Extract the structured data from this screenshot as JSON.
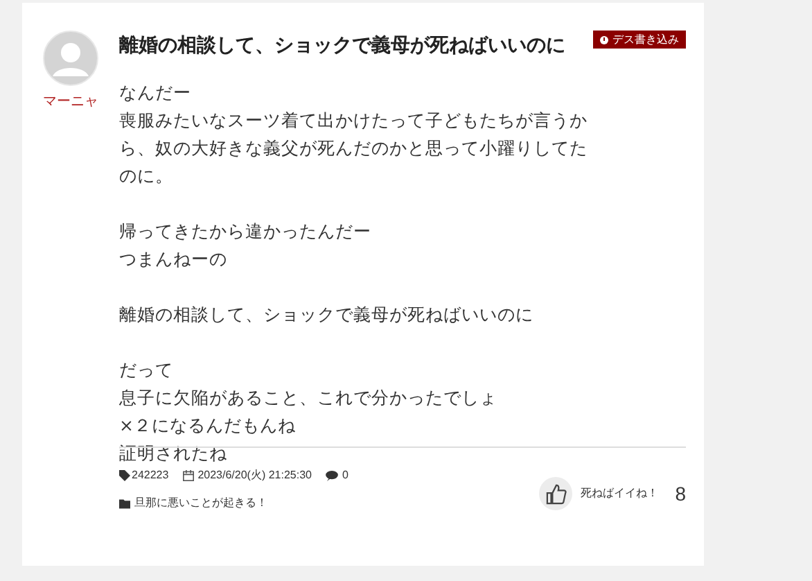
{
  "post": {
    "author": "マーニャ",
    "title": "離婚の相談して、ショックで義母が死ねばいいのに",
    "badge": "デス書き込み",
    "paragraphs": [
      [
        "なんだー",
        "喪服みたいなスーツ着て出かけたって子どもたちが言うから、奴の大好きな義父が死んだのかと思って小躍りしてたのに。"
      ],
      [
        "帰ってきたから違かったんだー",
        "つまんねーの"
      ],
      [
        "離婚の相談して、ショックで義母が死ねばいいのに"
      ],
      [
        "だって",
        "息子に欠陥があること、これで分かったでしょ",
        "×２になるんだもんね",
        "証明されたね"
      ]
    ],
    "id": "242223",
    "date": "2023/6/20(火) 21:25:30",
    "comments": "0",
    "category": "旦那に悪いことが起きる！",
    "like_label": "死ねばイイね！",
    "like_count": "8"
  }
}
